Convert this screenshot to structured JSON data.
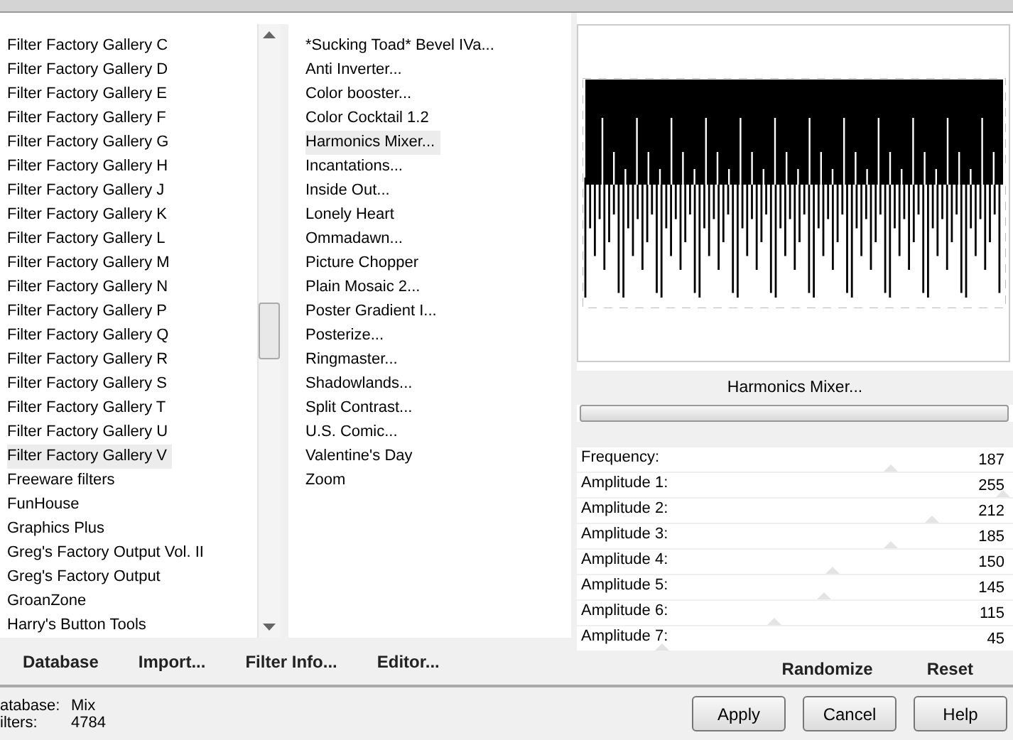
{
  "categories": [
    {
      "label": "Filter Factory Gallery C",
      "selected": false
    },
    {
      "label": "Filter Factory Gallery D",
      "selected": false
    },
    {
      "label": "Filter Factory Gallery E",
      "selected": false
    },
    {
      "label": "Filter Factory Gallery F",
      "selected": false
    },
    {
      "label": "Filter Factory Gallery G",
      "selected": false
    },
    {
      "label": "Filter Factory Gallery H",
      "selected": false
    },
    {
      "label": "Filter Factory Gallery J",
      "selected": false
    },
    {
      "label": "Filter Factory Gallery K",
      "selected": false
    },
    {
      "label": "Filter Factory Gallery L",
      "selected": false
    },
    {
      "label": "Filter Factory Gallery M",
      "selected": false
    },
    {
      "label": "Filter Factory Gallery N",
      "selected": false
    },
    {
      "label": "Filter Factory Gallery P",
      "selected": false
    },
    {
      "label": "Filter Factory Gallery Q",
      "selected": false
    },
    {
      "label": "Filter Factory Gallery R",
      "selected": false
    },
    {
      "label": "Filter Factory Gallery S",
      "selected": false
    },
    {
      "label": "Filter Factory Gallery T",
      "selected": false
    },
    {
      "label": "Filter Factory Gallery U",
      "selected": false
    },
    {
      "label": "Filter Factory Gallery V",
      "selected": true
    },
    {
      "label": "Freeware filters",
      "selected": false
    },
    {
      "label": "FunHouse",
      "selected": false
    },
    {
      "label": "Graphics Plus",
      "selected": false
    },
    {
      "label": "Greg's Factory Output Vol. II",
      "selected": false
    },
    {
      "label": "Greg's Factory Output",
      "selected": false
    },
    {
      "label": "GroanZone",
      "selected": false
    },
    {
      "label": "Harry's Button Tools",
      "selected": false
    }
  ],
  "filters": [
    {
      "label": "*Sucking Toad*  Bevel IVa...",
      "selected": false
    },
    {
      "label": "Anti Inverter...",
      "selected": false
    },
    {
      "label": "Color booster...",
      "selected": false
    },
    {
      "label": "Color Cocktail 1.2",
      "selected": false
    },
    {
      "label": "Harmonics Mixer...",
      "selected": true
    },
    {
      "label": "Incantations...",
      "selected": false
    },
    {
      "label": "Inside Out...",
      "selected": false
    },
    {
      "label": "Lonely Heart",
      "selected": false
    },
    {
      "label": "Ommadawn...",
      "selected": false
    },
    {
      "label": "Picture Chopper",
      "selected": false
    },
    {
      "label": "Plain Mosaic 2...",
      "selected": false
    },
    {
      "label": "Poster Gradient I...",
      "selected": false
    },
    {
      "label": "Posterize...",
      "selected": false
    },
    {
      "label": "Ringmaster...",
      "selected": false
    },
    {
      "label": "Shadowlands...",
      "selected": false
    },
    {
      "label": "Split Contrast...",
      "selected": false
    },
    {
      "label": "U.S. Comic...",
      "selected": false
    },
    {
      "label": "Valentine's Day",
      "selected": false
    },
    {
      "label": "Zoom",
      "selected": false
    }
  ],
  "list_buttons": [
    "Database",
    "Import...",
    "Filter Info...",
    "Editor..."
  ],
  "preview": {
    "filter_name": "Harmonics Mixer...",
    "progress": {
      "level": 0
    }
  },
  "sliders": [
    {
      "label": "Frequency:",
      "value": "187",
      "level": 0.73
    },
    {
      "label": "Amplitude 1:",
      "value": "255",
      "level": 1
    },
    {
      "label": "Amplitude 2:",
      "value": "212",
      "level": 0.83
    },
    {
      "label": "Amplitude 3:",
      "value": "185",
      "level": 0.73
    },
    {
      "label": "Amplitude 4:",
      "value": "150",
      "level": 0.59
    },
    {
      "label": "Amplitude 5:",
      "value": "145",
      "level": 0.57
    },
    {
      "label": "Amplitude 6:",
      "value": "115",
      "level": 0.45
    },
    {
      "label": "Amplitude 7:",
      "value": "45",
      "level": 0.18
    }
  ],
  "control_buttons": [
    "Randomize",
    "Reset"
  ],
  "status": [
    {
      "label": "atabase:",
      "value": "Mix"
    },
    {
      "label": "ilters:",
      "value": "4784"
    }
  ],
  "dialog_buttons": [
    "Apply",
    "Cancel",
    "Help"
  ]
}
